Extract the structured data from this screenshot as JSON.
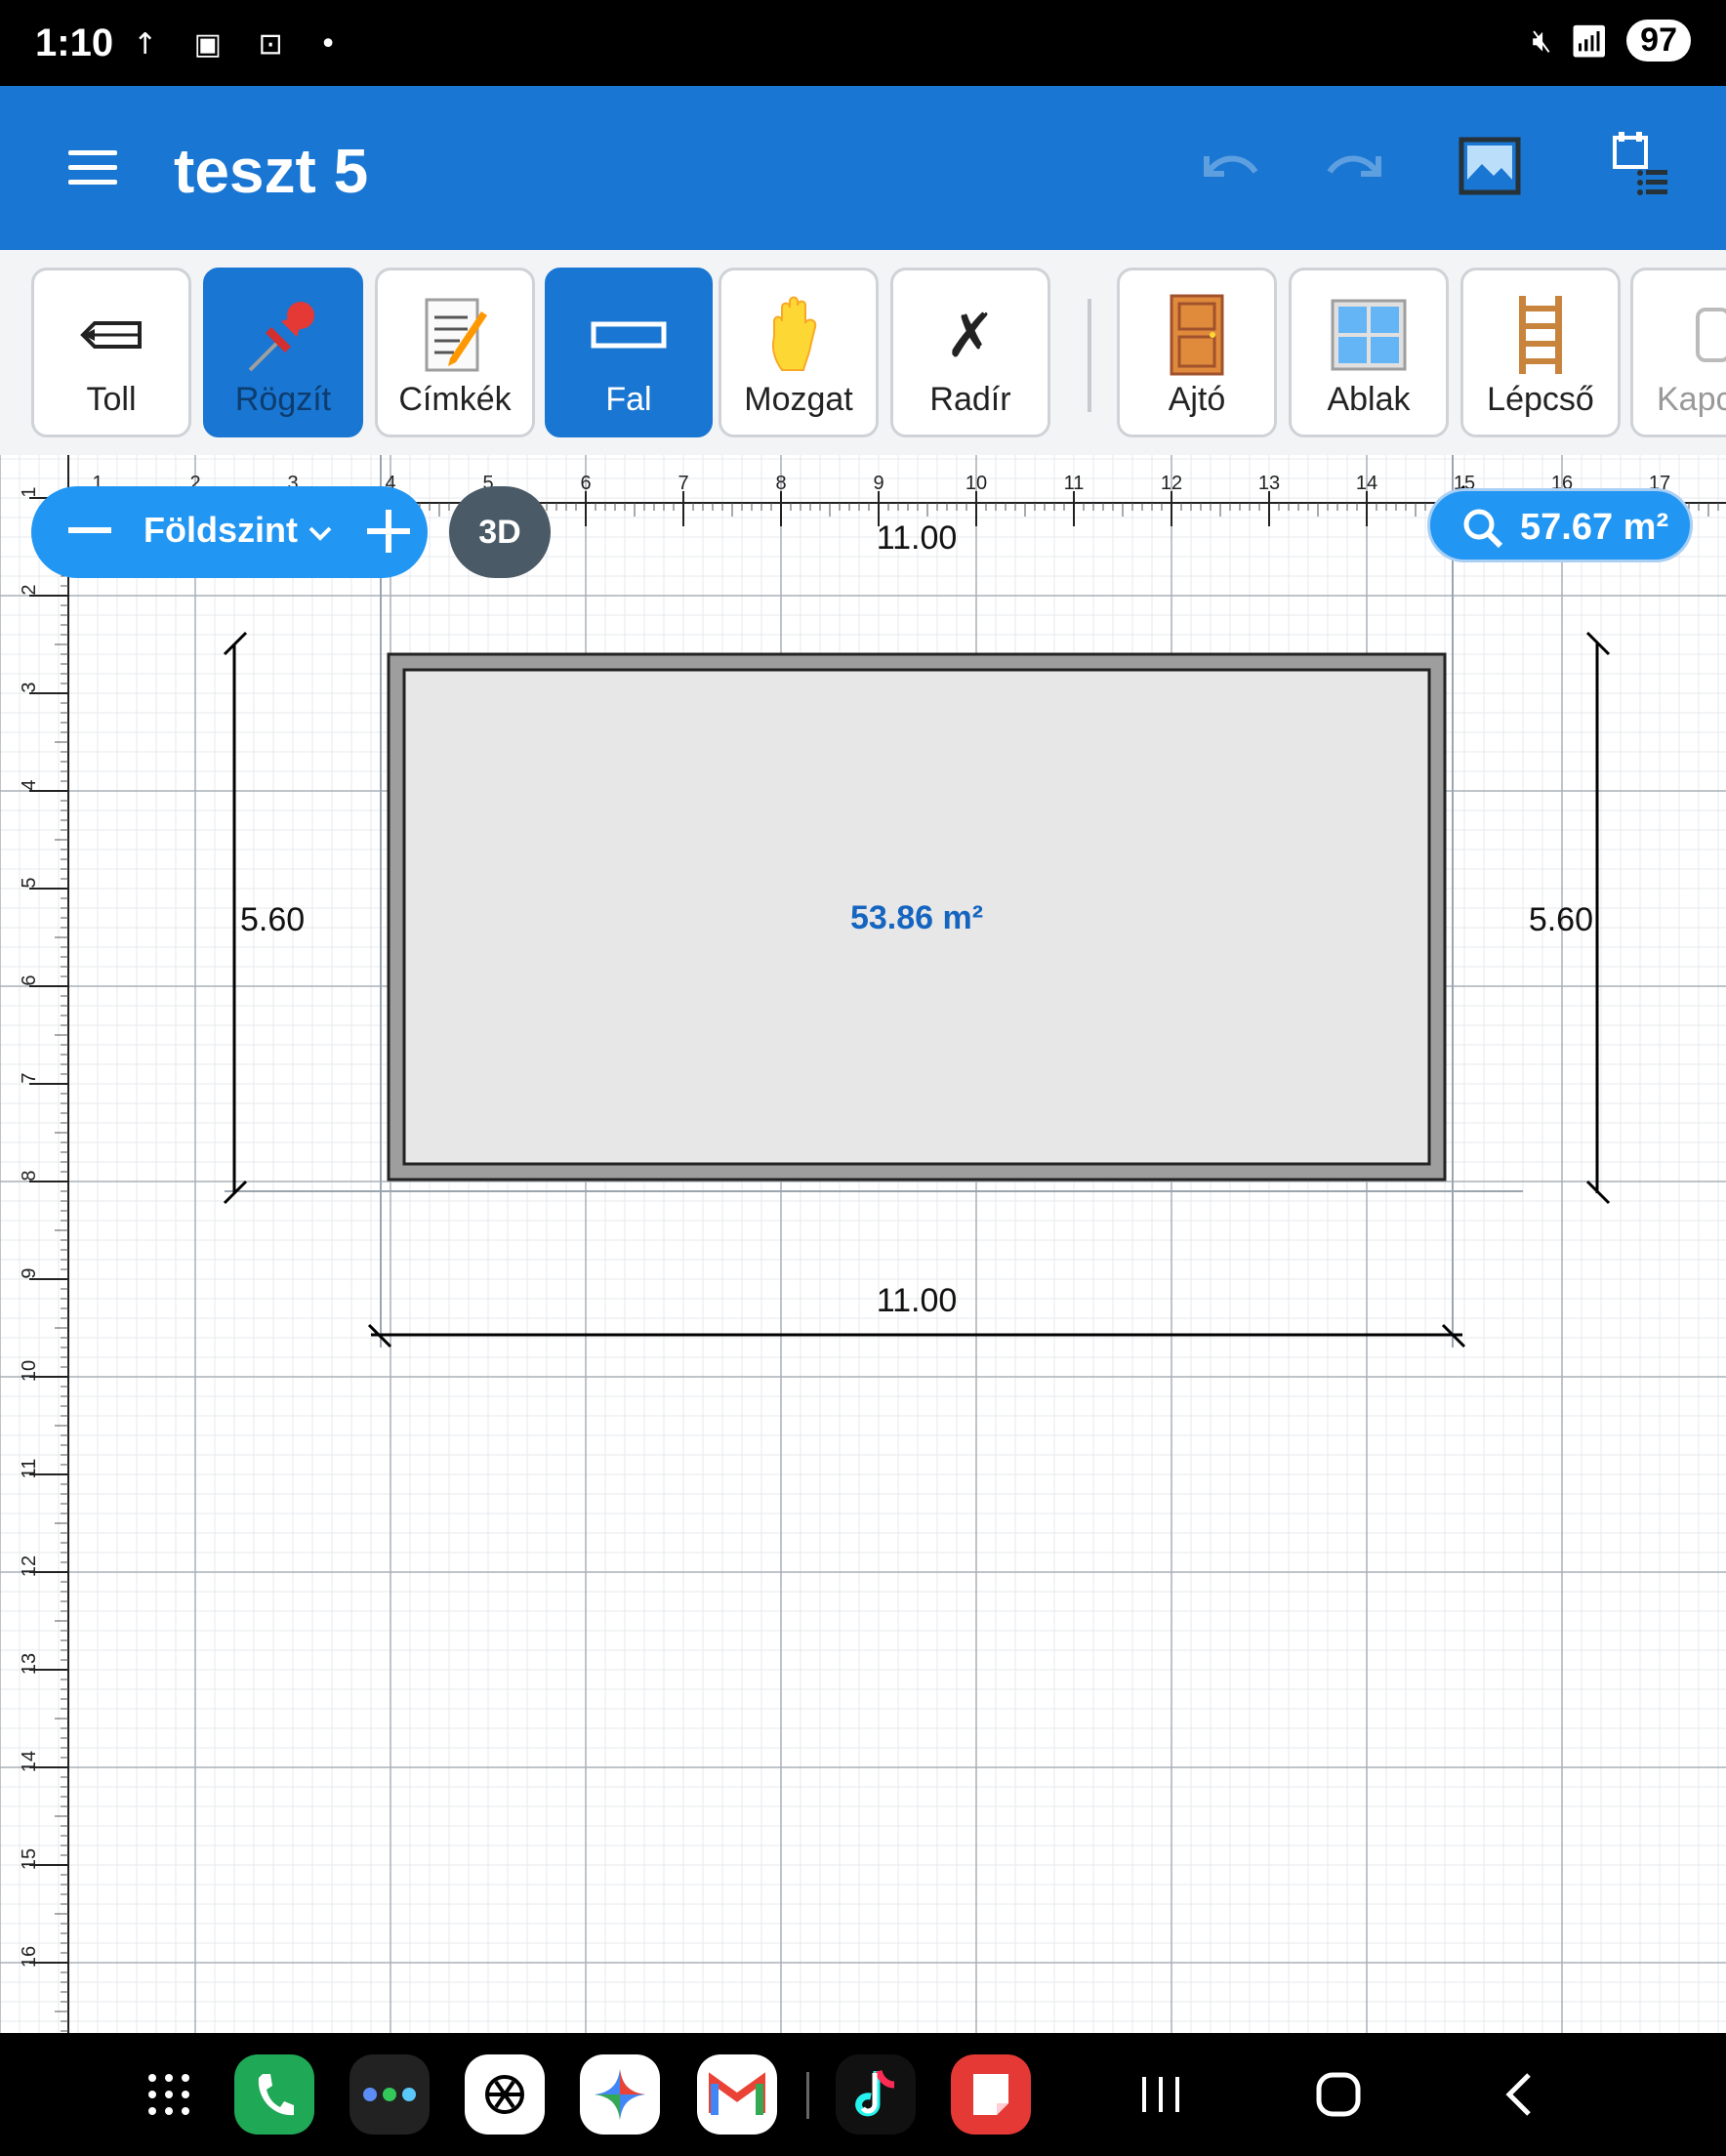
{
  "status": {
    "time": "1:10",
    "left_icons": "↑ ▣ ⊡ •",
    "battery": "97"
  },
  "app": {
    "title": "teszt 5"
  },
  "toolbar": {
    "tools": [
      {
        "label": "Toll",
        "icon": "pencil-icon",
        "active": false
      },
      {
        "label": "Rögzít",
        "icon": "pushpin-icon",
        "active": true
      },
      {
        "label": "Címkék",
        "icon": "memo-icon",
        "active": false
      },
      {
        "label": "Fal",
        "icon": "wall-icon",
        "active": true
      },
      {
        "label": "Mozgat",
        "icon": "hand-icon",
        "active": false
      },
      {
        "label": "Radír",
        "icon": "eraser-x-icon",
        "active": false
      },
      {
        "label": "Ajtó",
        "icon": "door-icon",
        "active": false
      },
      {
        "label": "Ablak",
        "icon": "window-icon",
        "active": false
      },
      {
        "label": "Lépcső",
        "icon": "ladder-icon",
        "active": false
      },
      {
        "label": "Kapc",
        "icon": "switch-icon",
        "active": false
      }
    ]
  },
  "floorplan": {
    "level_name": "Földszint",
    "view_3d_label": "3D",
    "total_area": "57.67 m²",
    "room_area": "53.86 m²",
    "dim_top": "11.00",
    "dim_bottom": "11.00",
    "dim_left": "5.60",
    "dim_right": "5.60",
    "ruler_x_labels": [
      "1",
      "2",
      "3",
      "4",
      "5",
      "6",
      "7",
      "8",
      "9",
      "10",
      "11",
      "12",
      "13",
      "14",
      "15",
      "16",
      "17"
    ],
    "ruler_y_labels": [
      "1",
      "2",
      "3",
      "4",
      "5",
      "6",
      "7",
      "8",
      "9",
      "10",
      "11",
      "12",
      "13",
      "14",
      "15",
      "16"
    ]
  },
  "colors": {
    "primary": "#1976d2",
    "accent": "#2196f3",
    "wall": "#9e9e9e",
    "area_text": "#1565c0"
  },
  "nav": {
    "apps": [
      "apps-grid-icon",
      "phone-icon",
      "folder-icon",
      "chatgpt-icon",
      "gemini-icon",
      "gmail-icon",
      "tiktok-icon",
      "notes-icon"
    ]
  }
}
